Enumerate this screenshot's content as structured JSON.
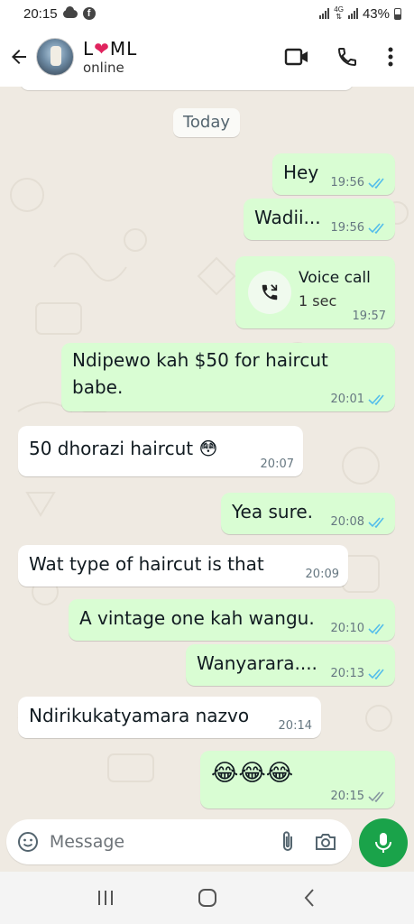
{
  "status_bar": {
    "time": "20:15",
    "network": "4G",
    "battery": "43%"
  },
  "header": {
    "contact_name_prefix": "L",
    "contact_name_suffix": "ML",
    "heart": "❤",
    "status": "online",
    "icons": [
      "back-arrow-icon",
      "video-call-icon",
      "phone-icon",
      "more-vert-icon"
    ]
  },
  "chat": {
    "date_label": "Today",
    "messages": [
      {
        "dir": "out",
        "text": "Hey",
        "time": "19:56",
        "read": true
      },
      {
        "dir": "out",
        "text": "Wadii...",
        "time": "19:56",
        "read": true
      },
      {
        "dir": "out",
        "type": "call",
        "title": "Voice call",
        "duration": "1 sec",
        "time": "19:57"
      },
      {
        "dir": "out",
        "lines": [
          "Ndipewo kah $50 for haircut",
          "babe."
        ],
        "time": "20:01",
        "read": true
      },
      {
        "dir": "in",
        "text": "50 dhorazi haircut 😳",
        "time": "20:07"
      },
      {
        "dir": "out",
        "text": "Yea sure.",
        "time": "20:08",
        "read": true
      },
      {
        "dir": "in",
        "text": "Wat type of haircut is that",
        "time": "20:09"
      },
      {
        "dir": "out",
        "text": "A vintage one kah wangu.",
        "time": "20:10",
        "read": true
      },
      {
        "dir": "out",
        "text": "Wanyarara....",
        "time": "20:13",
        "read": true
      },
      {
        "dir": "in",
        "text": "Ndirikukatyamara nazvo",
        "time": "20:14"
      },
      {
        "dir": "out",
        "text": "😂😂😂",
        "time": "20:15",
        "read": false
      }
    ]
  },
  "input": {
    "placeholder": "Message",
    "value": ""
  },
  "colors": {
    "outgoing_bubble": "#d9fdd3",
    "incoming_bubble": "#ffffff",
    "chat_background": "#efeae2",
    "read_tick": "#53bdeb",
    "mic_button": "#1aa34a"
  }
}
